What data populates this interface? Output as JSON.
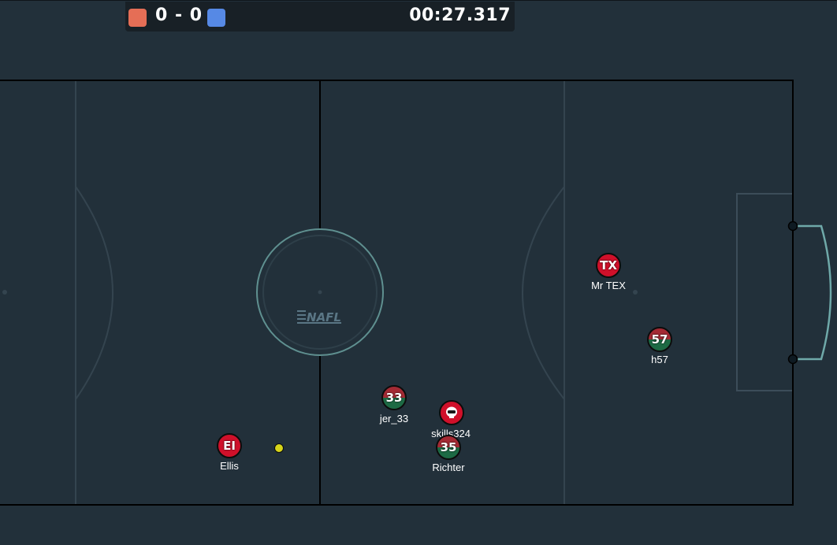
{
  "scoreboard": {
    "red_color": "#e56e56",
    "blue_color": "#5689e5",
    "score": "0 - 0",
    "timer": "00:27.317"
  },
  "pitch": {
    "logo_text": "NAFL",
    "line_color": "#000000",
    "marking_color": "#3b4c58",
    "goal_color": "#6fa9a9"
  },
  "ball_color": "#d7d51a",
  "players": [
    {
      "avatar": "EI",
      "name": "Ellis",
      "team": "red"
    },
    {
      "avatar": "33",
      "name": "jer_33",
      "team": "green"
    },
    {
      "avatar": "skull-icon",
      "name": "skills324",
      "team": "red"
    },
    {
      "avatar": "35",
      "name": "Richter",
      "team": "green"
    },
    {
      "avatar": "TX",
      "name": "Mr TEX",
      "team": "red"
    },
    {
      "avatar": "57",
      "name": "h57",
      "team": "green"
    }
  ]
}
